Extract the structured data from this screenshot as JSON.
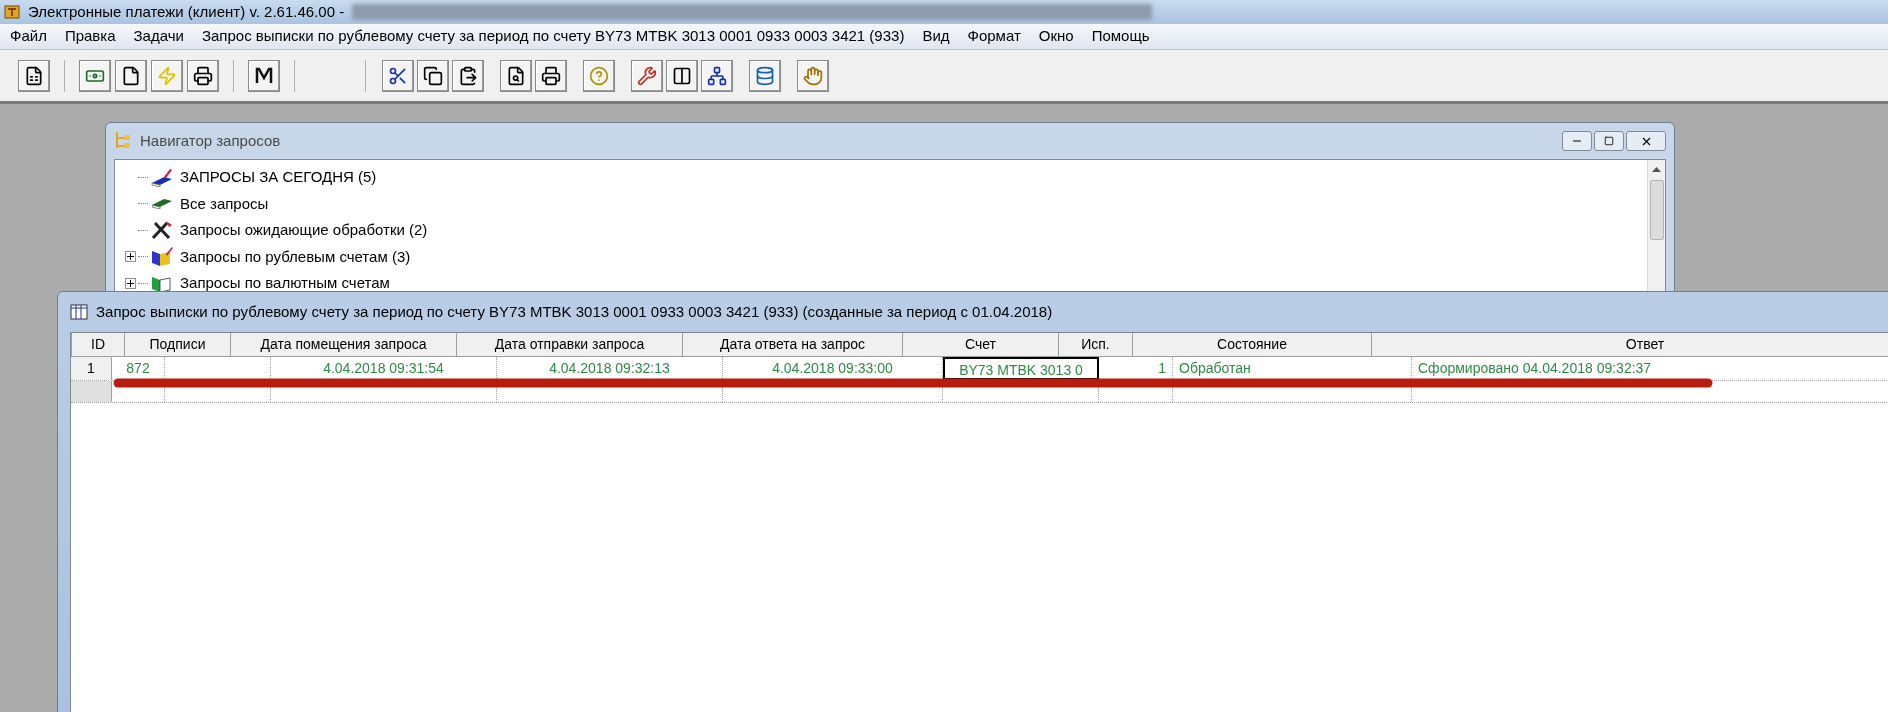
{
  "window": {
    "title": "Электронные платежи (клиент) v. 2.61.46.00 -"
  },
  "menu": [
    {
      "label": "Файл"
    },
    {
      "label": "Правка"
    },
    {
      "label": "Задачи"
    },
    {
      "label": "Запрос выписки по рублевому счету за период по счету BY73 MTBK 3013 0001 0933 0003 3421 (933)"
    },
    {
      "label": "Вид"
    },
    {
      "label": "Формат"
    },
    {
      "label": "Окно"
    },
    {
      "label": "Помощь"
    }
  ],
  "navigator": {
    "title": "Навигатор запросов",
    "items": [
      {
        "label": "ЗАПРОСЫ ЗА СЕГОДНЯ (5)",
        "kind": "today",
        "expandable": false
      },
      {
        "label": "Все запросы",
        "kind": "all",
        "expandable": false
      },
      {
        "label": "Запросы ожидающие обработки (2)",
        "kind": "pending",
        "expandable": false
      },
      {
        "label": "Запросы по рублевым счетам (3)",
        "kind": "rub",
        "expandable": true
      },
      {
        "label": "Запросы по валютным счетам",
        "kind": "currency",
        "expandable": true
      }
    ]
  },
  "grid_window": {
    "title": "Запрос выписки по рублевому счету за период по счету BY73 MTBK 3013 0001 0933 0003 3421 (933) (созданные за период с 01.04.2018)",
    "columns": [
      "ID",
      "Подписи",
      "Дата помещения запроса",
      "Дата отправки запроса",
      "Дата ответа на запрос",
      "Счет",
      "Исп.",
      "Состояние",
      "Ответ"
    ],
    "rows": [
      {
        "number": "1",
        "cells": [
          {
            "text": "872",
            "selected": false
          },
          {
            "text": "",
            "selected": false
          },
          {
            "text": "4.04.2018 09:31:54",
            "selected": false
          },
          {
            "text": "4.04.2018 09:32:13",
            "selected": false
          },
          {
            "text": "4.04.2018 09:33:00",
            "selected": false
          },
          {
            "text": "BY73 MTBK 3013 0",
            "selected": true
          },
          {
            "text": "1",
            "selected": false
          },
          {
            "text": "Обработан",
            "selected": false
          },
          {
            "text": "Сформировано 04.04.2018 09:32:37",
            "selected": false
          }
        ]
      }
    ]
  }
}
